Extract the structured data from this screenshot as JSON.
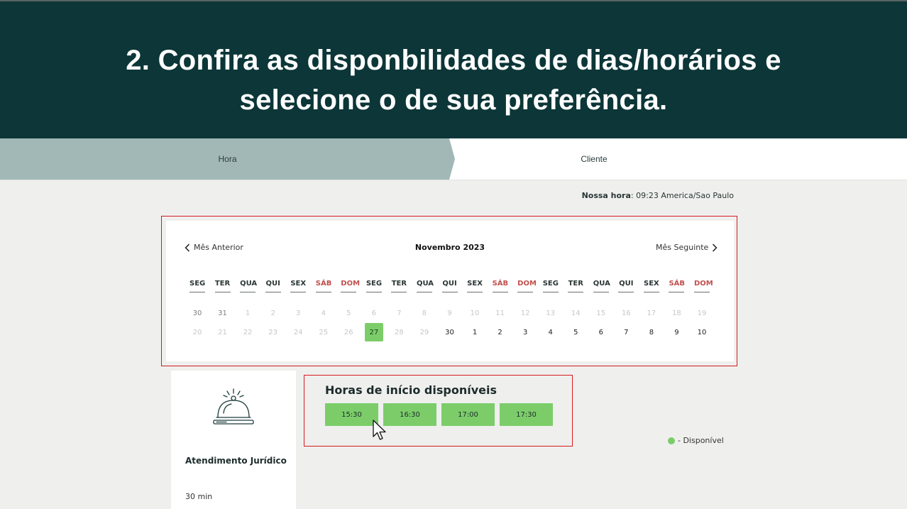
{
  "banner": {
    "title_line1": "2. Confira as disponbilidades de dias/horários e",
    "title_line2": "selecione o de sua preferência."
  },
  "steps": {
    "hora": "Hora",
    "cliente": "Cliente"
  },
  "our_time": {
    "label": "Nossa hora",
    "value": ": 09:23 America/Sao Paulo"
  },
  "calendar": {
    "prev_label": "Mês Anterior",
    "next_label": "Mês Seguinte",
    "month": "Novembro 2023",
    "weekdays": [
      "SEG",
      "TER",
      "QUA",
      "QUI",
      "SEX",
      "SÁB",
      "DOM",
      "SEG",
      "TER",
      "QUA",
      "QUI",
      "SEX",
      "SÁB",
      "DOM",
      "SEG",
      "TER",
      "QUA",
      "QUI",
      "SEX",
      "SÁB",
      "DOM"
    ],
    "row1": [
      "30",
      "31",
      "1",
      "2",
      "3",
      "4",
      "5",
      "6",
      "7",
      "8",
      "9",
      "10",
      "11",
      "12",
      "13",
      "14",
      "15",
      "16",
      "17",
      "18",
      "19"
    ],
    "row2": [
      "20",
      "21",
      "22",
      "23",
      "24",
      "25",
      "26",
      "27",
      "28",
      "29",
      "30",
      "1",
      "2",
      "3",
      "4",
      "5",
      "6",
      "7",
      "8",
      "9",
      "10"
    ],
    "selected_day": "27",
    "colors": {
      "selected": "#7ccd6a",
      "weekend": "#c0504d"
    }
  },
  "service": {
    "name": "Atendimento Jurídico",
    "duration": "30 min",
    "icon": "service-bell-icon"
  },
  "times": {
    "title": "Horas de início disponíveis",
    "slots": [
      "15:30",
      "16:30",
      "17:00",
      "17:30"
    ]
  },
  "legend": {
    "label": "- Disponível",
    "color": "#7ccd6a"
  }
}
